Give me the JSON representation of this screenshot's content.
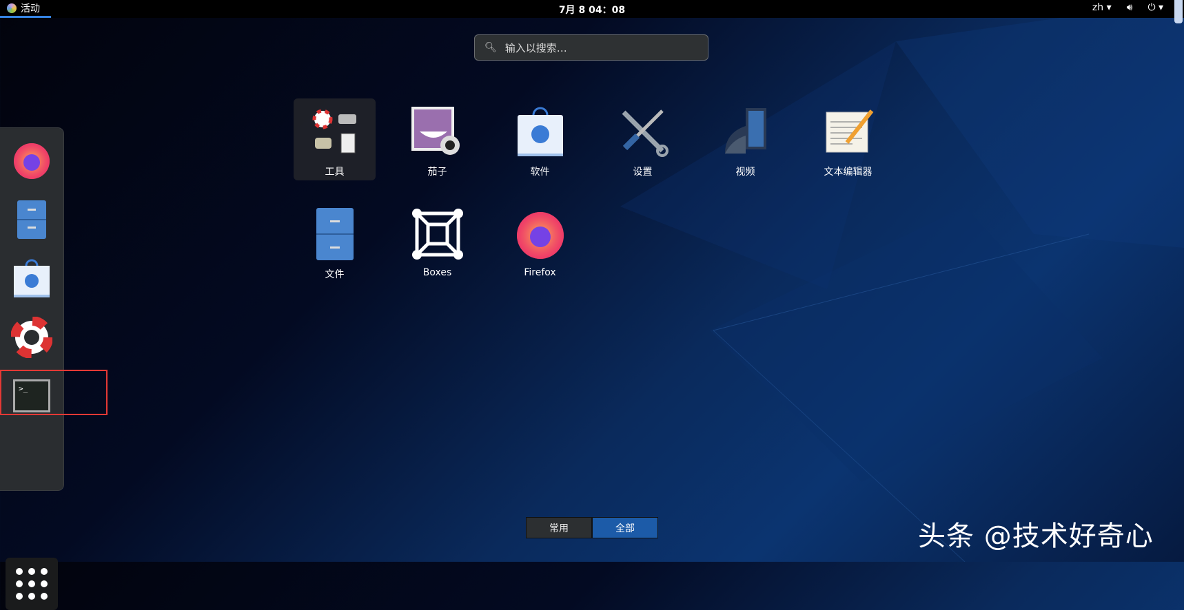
{
  "topbar": {
    "activities": "活动",
    "clock": "7月 8 04：08",
    "language": "zh"
  },
  "search": {
    "placeholder": "输入以搜索…"
  },
  "dock": {
    "items": [
      "Firefox",
      "文件",
      "软件",
      "帮助",
      "终端"
    ],
    "show_apps": "显示应用程序"
  },
  "apps": [
    {
      "label": "工具",
      "icon": "utilities-folder-icon"
    },
    {
      "label": "茄子",
      "icon": "cheese-icon"
    },
    {
      "label": "软件",
      "icon": "software-icon"
    },
    {
      "label": "设置",
      "icon": "settings-icon"
    },
    {
      "label": "视频",
      "icon": "videos-icon"
    },
    {
      "label": "文本编辑器",
      "icon": "text-editor-icon"
    },
    {
      "label": "文件",
      "icon": "files-icon"
    },
    {
      "label": "Boxes",
      "icon": "boxes-icon"
    },
    {
      "label": "Firefox",
      "icon": "firefox-icon"
    }
  ],
  "view_tabs": {
    "frequent": "常用",
    "all": "全部"
  },
  "watermark": "头条 @技术好奇心",
  "colors": {
    "accent": "#3584e4",
    "highlight_red": "#e53935",
    "active_tab": "#1c5ba8"
  }
}
